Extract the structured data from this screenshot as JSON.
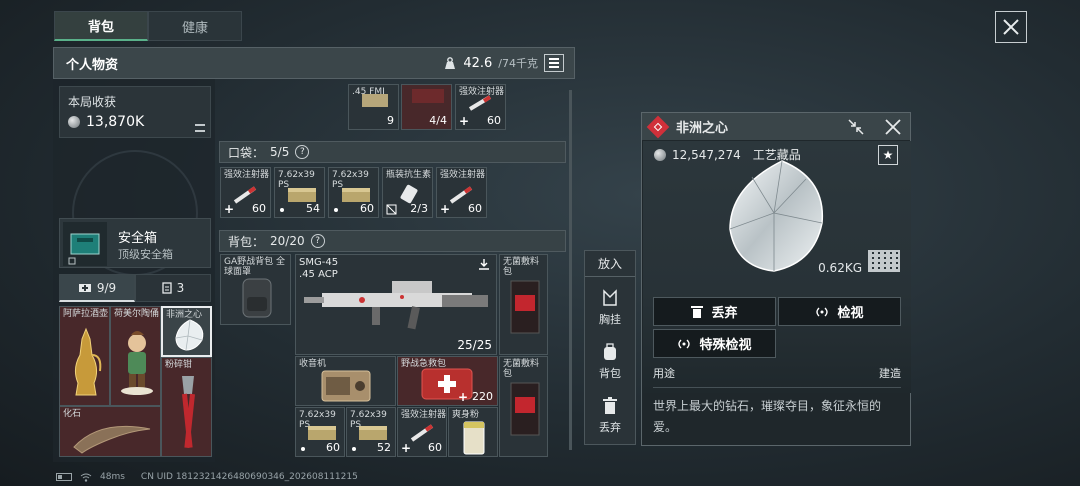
{
  "tabs": [
    {
      "label": "背包",
      "active": true
    },
    {
      "label": "健康",
      "active": false
    }
  ],
  "inventory": {
    "title": "个人物资",
    "weight_current": "42.6",
    "weight_max": "/74千克"
  },
  "earnings": {
    "label": "本局收获",
    "value": "13,870K"
  },
  "safebox": {
    "name": "安全箱",
    "subtitle": "顶级安全箱"
  },
  "sub_tabs": [
    {
      "label": "9/9",
      "icon": "medkit-icon"
    },
    {
      "label": "3",
      "icon": "clipboard-icon"
    }
  ],
  "safe_items": [
    {
      "name": "阿萨拉酒壶"
    },
    {
      "name": "荷美尔陶俑"
    },
    {
      "name": "非洲之心"
    },
    {
      "name": "粉碎钳"
    },
    {
      "name": "化石"
    }
  ],
  "top_row": [
    {
      "label": ".45 FMJ",
      "count": "9"
    },
    {
      "label": "",
      "count": "4/4"
    },
    {
      "label": "强效注射器",
      "count": "60"
    }
  ],
  "pocket": {
    "title": "口袋：",
    "count": "5/5",
    "items": [
      {
        "label": "强效注射器",
        "count": "60",
        "prefix": "+"
      },
      {
        "label": "7.62x39 PS",
        "count": "54",
        "prefix": "•"
      },
      {
        "label": "7.62x39 PS",
        "count": "60",
        "prefix": "•"
      },
      {
        "label": "瓶装抗生素",
        "count": "2/3",
        "prefix": ""
      },
      {
        "label": "强效注射器",
        "count": "60",
        "prefix": "+"
      }
    ]
  },
  "backpack": {
    "title": "背包：",
    "count": "20/20",
    "bag": {
      "label": "GA野战背包 全球面罩"
    },
    "gun": {
      "name": "SMG-45",
      "caliber": ".45 ACP",
      "ammo": "25/25"
    },
    "radio": {
      "label": "收音机"
    },
    "medkit": {
      "label": "野战急救包",
      "count": "220"
    },
    "sterile1": {
      "label": "无菌敷料包"
    },
    "sterile2": {
      "label": "无菌敷料包"
    },
    "ammo1": {
      "label": "7.62x39 PS",
      "count": "60"
    },
    "ammo2": {
      "label": "7.62x39 PS",
      "count": "52"
    },
    "inj": {
      "label": "强效注射器",
      "count": "60"
    },
    "lasted": {
      "label": "爽身粉"
    }
  },
  "side_actions": {
    "put": "放入",
    "chest": "胸挂",
    "bag": "背包",
    "discard": "丢弃"
  },
  "detail": {
    "name": "非洲之心",
    "price": "12,547,274",
    "category": "工艺藏品",
    "weight": "0.62KG",
    "btn_discard": "丢弃",
    "btn_inspect": "检视",
    "btn_special": "特殊检视",
    "use_label": "用途",
    "build_label": "建造",
    "description": "世界上最大的钻石，璀璨夺目，象征永恒的爱。"
  },
  "status": {
    "ping": "48ms",
    "uid": "CN UID 1812321426480690346_202608111215"
  },
  "colors": {
    "accent_green": "#5ab18a",
    "badge_red": "#d0303a",
    "panel": "#2a3338"
  }
}
